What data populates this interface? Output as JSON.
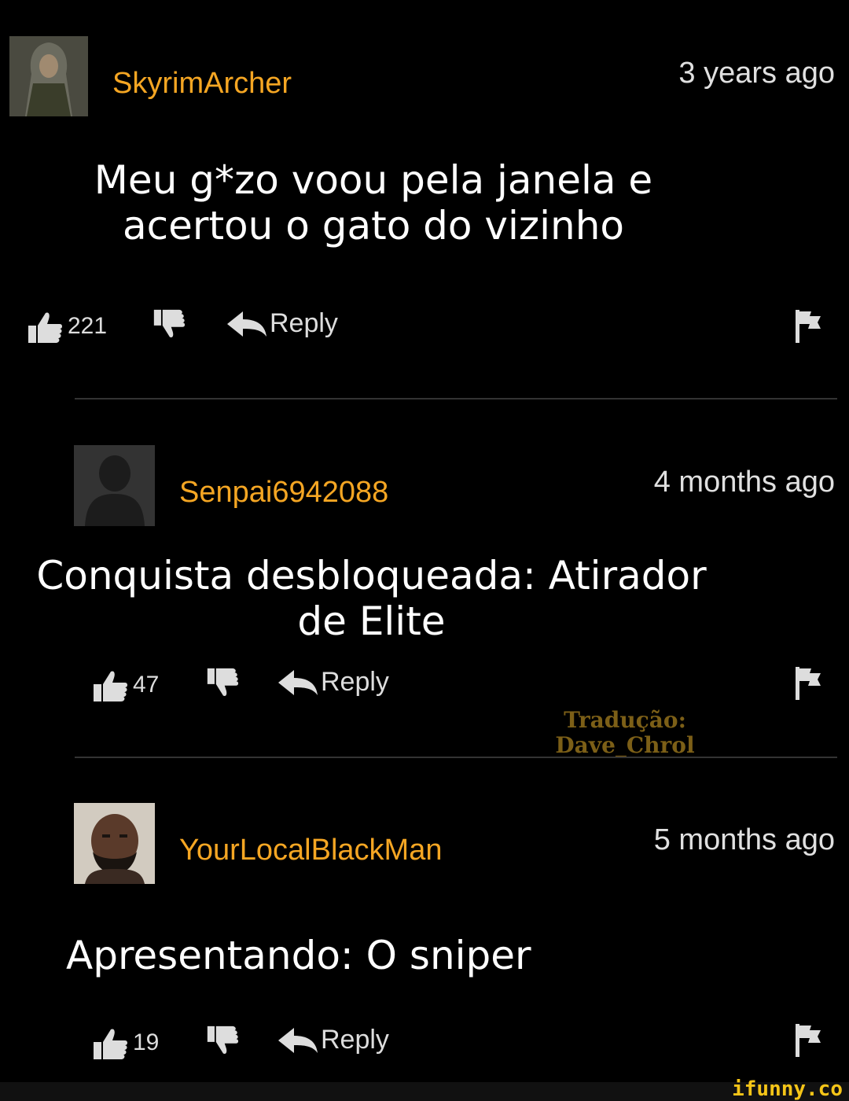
{
  "comments": [
    {
      "username": "SkyrimArcher",
      "time": "3 years ago",
      "text_line1": "Meu g*zo voou pela janela e",
      "text_line2": "acertou o gato do vizinho",
      "likes": "221",
      "reply_label": "Reply"
    },
    {
      "username": "Senpai6942088",
      "time": "4 months ago",
      "text_line1": "Conquista desbloqueada: Atirador",
      "text_line2": "de Elite",
      "likes": "47",
      "reply_label": "Reply"
    },
    {
      "username": "YourLocalBlackMan",
      "time": "5 months ago",
      "text_line1": "Apresentando: O sniper",
      "likes": "19",
      "reply_label": "Reply"
    }
  ],
  "watermark": {
    "line1": "Tradução:",
    "line2": "Dave_Chrol"
  },
  "site_logo": "ifunny.co",
  "colors": {
    "username": "#f5a623",
    "background": "#000000"
  }
}
